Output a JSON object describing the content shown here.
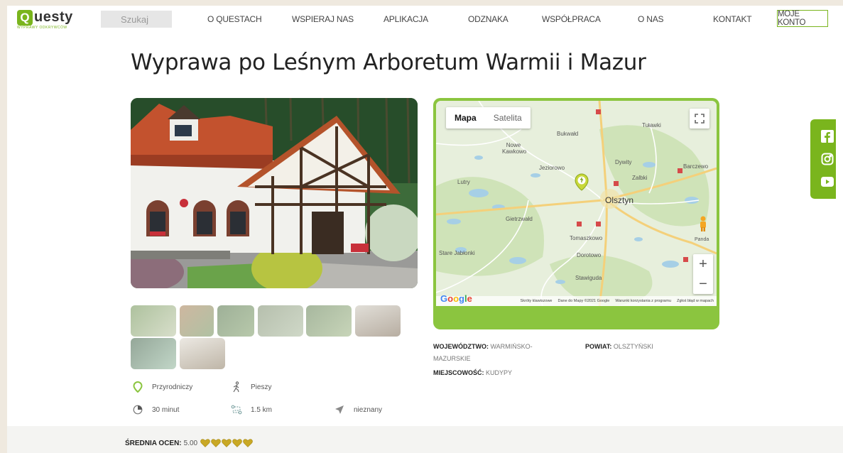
{
  "header": {
    "logo_letter": "Q",
    "logo_text": "uesty",
    "logo_tagline": "WYPRAWY ODKRYWCÓW",
    "search_placeholder": "Szukaj",
    "nav": [
      "O QUESTACH",
      "WSPIERAJ NAS",
      "APLIKACJA",
      "ODZNAKA",
      "WSPÓŁPRACA",
      "O NAS",
      "KONTAKT"
    ],
    "account_label": "MOJE KONTO"
  },
  "title": "Wyprawa po Leśnym Arboretum Warmii i Mazur",
  "gallery": {
    "thumbnail_count": 8
  },
  "attributes": {
    "category": "Przyrodniczy",
    "mode": "Pieszy",
    "duration": "30 minut",
    "distance": "1.5 km",
    "direction": "nieznany"
  },
  "map": {
    "tabs": [
      "Mapa",
      "Satelita"
    ],
    "active_tab": "Mapa",
    "places": [
      "Tuławki",
      "Bukwałd",
      "Nowe Kawkowo",
      "Jeziorowo",
      "Dywity",
      "Barczewo",
      "Zalbki",
      "Lutry",
      "Olsztyn",
      "Gietrzwałd",
      "Tomaszkowo",
      "Stare Jabłonki",
      "Dorotowo",
      "Stawiguda"
    ],
    "provider": "Google",
    "attribution": [
      "Skróty klawiszowe",
      "Dane do Mapy ©2021 Google",
      "Warunki korzystania z programu",
      "Zgłoś błąd w mapach"
    ],
    "pegman_label": "Panda"
  },
  "location": {
    "voivodeship_label": "WOJEWÓDZTWO:",
    "voivodeship_value": "WARMIŃSKO-MAZURSKIE",
    "county_label": "POWIAT:",
    "county_value": "OLSZTYŃSKI",
    "town_label": "MIEJSCOWOŚĆ:",
    "town_value": "KUDYPY"
  },
  "social": [
    "facebook-icon",
    "instagram-icon",
    "youtube-icon"
  ],
  "rating": {
    "label": "ŚREDNIA OCEN:",
    "value": "5.00",
    "hearts": 5
  },
  "colors": {
    "brand": "#7ab51d",
    "map_frame": "#8bc53f",
    "heart": "#c9a825"
  }
}
